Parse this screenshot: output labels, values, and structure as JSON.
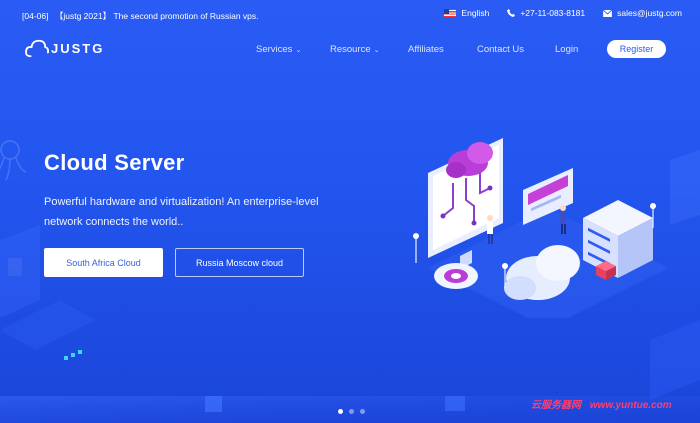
{
  "topbar": {
    "date": "[04-06]",
    "bracket_text": "【justg 2021】",
    "notice": "The second promotion of Russian vps.",
    "language": "English",
    "phone": "+27-11-083-8181",
    "email": "sales@justg.com"
  },
  "nav": {
    "logo_text": "JUSTG",
    "menu": [
      {
        "label": "Services",
        "has_dropdown": true
      },
      {
        "label": "Resource",
        "has_dropdown": true
      },
      {
        "label": "Affiliates",
        "has_dropdown": false
      },
      {
        "label": "Contact Us",
        "has_dropdown": false
      },
      {
        "label": "Login",
        "has_dropdown": false
      }
    ],
    "register_label": "Register"
  },
  "hero": {
    "title": "Cloud Server",
    "subtitle": "Powerful hardware and virtualization! An enterprise-level network connects the world..",
    "primary_button": "South Africa Cloud",
    "secondary_button": "Russia Moscow cloud"
  },
  "carousel": {
    "slides": 3,
    "active": 1
  },
  "watermark": {
    "cn": "云服务器网",
    "url": "www.yuntue.com"
  },
  "colors": {
    "background": "#2255ee",
    "accent_pink": "#c640d8",
    "white": "#ffffff"
  }
}
